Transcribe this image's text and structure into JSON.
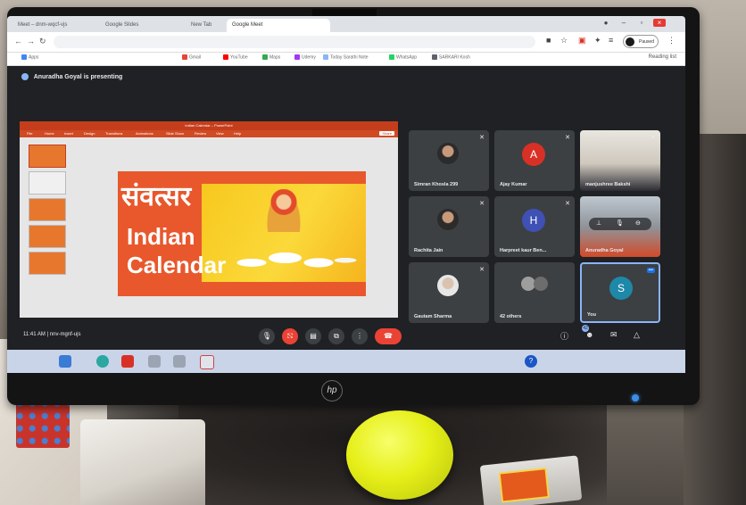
{
  "browser": {
    "tabs": [
      {
        "label": "Meet – dnm-wqcf-vjs"
      },
      {
        "label": "Google Slides"
      },
      {
        "label": "New Tab"
      },
      {
        "label": "Google Meet"
      }
    ],
    "profile_label": "Paused",
    "reading_list": "Reading list",
    "bookmarks": [
      {
        "label": "Apps",
        "color": "#4285f4"
      },
      {
        "label": "Gmail",
        "color": "#ea4335"
      },
      {
        "label": "YouTube",
        "color": "#ff0000"
      },
      {
        "label": "Maps",
        "color": "#34a853"
      },
      {
        "label": "Udemy",
        "color": "#a435f0"
      },
      {
        "label": "Today Sarathi Note",
        "color": "#8ab4f8"
      },
      {
        "label": "WhatsApp",
        "color": "#25d366"
      },
      {
        "label": "SARKARI Kosh",
        "color": "#5f6368"
      }
    ]
  },
  "meet": {
    "presenting": "Anuradha Goyal is presenting",
    "time_code": "11:41 AM  |  nnv-mgnf-ujs",
    "others_badge": "42",
    "participants": [
      {
        "name": "Simran Khosla 299",
        "kind": "photo"
      },
      {
        "name": "Ajay Kumar",
        "kind": "letter",
        "letter": "A",
        "color": "#d93025"
      },
      {
        "name": "manjushree Bakshi",
        "kind": "video"
      },
      {
        "name": "Rachita Jain",
        "kind": "photo"
      },
      {
        "name": "Harpreet kaur Ben...",
        "kind": "letter",
        "letter": "H",
        "color": "#3f51b5"
      },
      {
        "name": "Anuradha Goyal",
        "kind": "video-controls"
      },
      {
        "name": "Gautam Sharma",
        "kind": "photo"
      },
      {
        "name": "42 others",
        "kind": "others"
      },
      {
        "name": "You",
        "kind": "letter",
        "letter": "S",
        "color": "#1e88a8"
      }
    ]
  },
  "presentation": {
    "app_title": "Indian Calendar – PowerPoint",
    "ribbon_tabs": [
      "File",
      "Home",
      "Insert",
      "Design",
      "Transitions",
      "Animations",
      "Slide Show",
      "Review",
      "View",
      "Help"
    ],
    "share_label": "Share",
    "slide": {
      "hindi_title": "संवत्सर",
      "title_line_1": "Indian",
      "title_line_2": "Calendar"
    }
  },
  "colors": {
    "meet_bg": "#202124",
    "tile_bg": "#3c4043",
    "slide_orange": "#e8582c",
    "slide_yellow": "#f7c81e",
    "end_call": "#ea4335"
  },
  "icons": {
    "mic": "🎙",
    "camera": "⛞",
    "captions": "▤",
    "present": "⧉",
    "more": "⋮",
    "end": "☎",
    "info": "ⓘ",
    "people": "☻",
    "chat": "✉",
    "activities": "△",
    "mic_off": "✕"
  }
}
